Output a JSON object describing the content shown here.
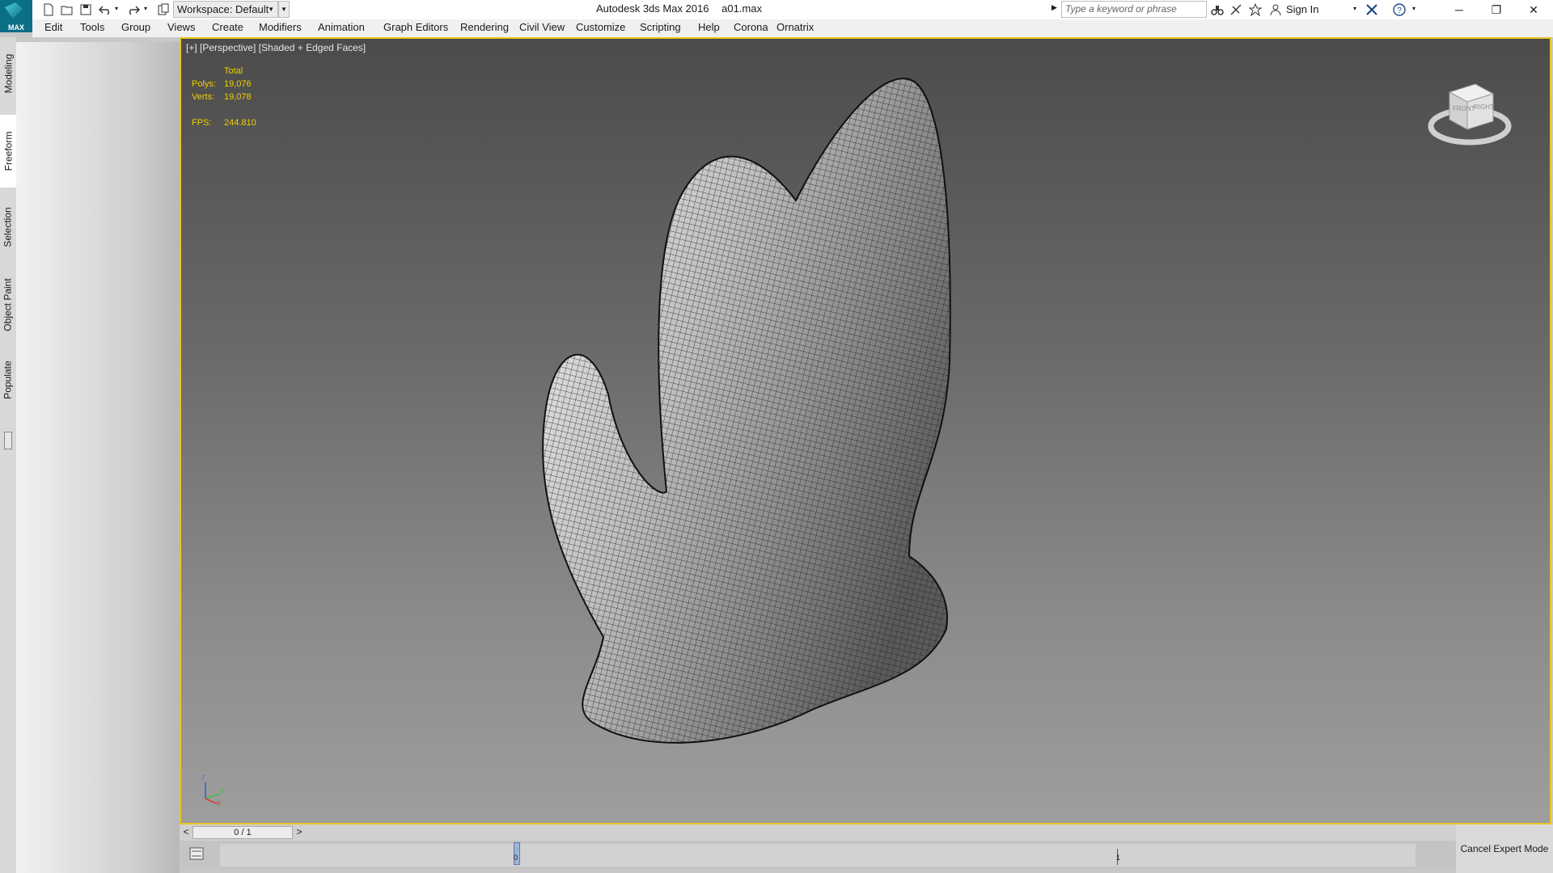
{
  "app": {
    "logo_text": "MAX",
    "title": "Autodesk 3ds Max 2016",
    "file_name": "a01.max",
    "workspace": "Workspace: Default"
  },
  "quick_access": {
    "icons": [
      "new-file-icon",
      "open-file-icon",
      "save-icon",
      "undo-icon",
      "redo-icon",
      "project-folder-icon"
    ]
  },
  "infocenter": {
    "search_placeholder": "Type a keyword or phrase",
    "sign_in": "Sign In"
  },
  "window_controls": {
    "minimize": "─",
    "restore": "❐",
    "close": "✕"
  },
  "menu": [
    "Edit",
    "Tools",
    "Group",
    "Views",
    "Create",
    "Modifiers",
    "Animation",
    "Graph Editors",
    "Rendering",
    "Civil View",
    "Customize",
    "Scripting",
    "Help",
    "Corona",
    "Ornatrix"
  ],
  "left_tabs": [
    {
      "label": "Modeling",
      "active": false
    },
    {
      "label": "Freeform",
      "active": true
    },
    {
      "label": "Selection",
      "active": false
    },
    {
      "label": "Object Paint",
      "active": false
    },
    {
      "label": "Populate",
      "active": false
    }
  ],
  "viewport": {
    "label": "[+] [Perspective] [Shaded + Edged Faces]",
    "stats": {
      "header": "Total",
      "polys_label": "Polys:",
      "polys": "19,076",
      "verts_label": "Verts:",
      "verts": "19,078",
      "fps_label": "FPS:",
      "fps": "244.810"
    },
    "viewcube_labels": [
      "FRONT",
      "RIGHT"
    ],
    "axis_labels": [
      "z",
      "y",
      "x"
    ],
    "border_color": "#e8c820"
  },
  "timeline": {
    "prev": "<",
    "next": ">",
    "slider": "0 / 1",
    "frame_start": "0",
    "frame_end": "1"
  },
  "cancel_expert_mode": "Cancel Expert Mode"
}
